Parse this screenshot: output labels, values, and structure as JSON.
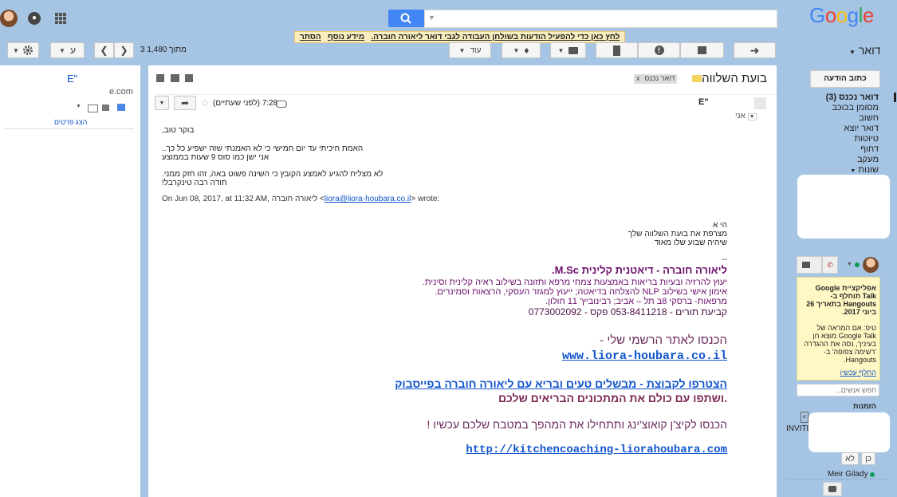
{
  "topbar": {
    "search_placeholder": "",
    "logo": "Google",
    "notice_text": "לחץ כאן כדי להפעיל הודעות בשולחן העבודה לגבי דואר ליאורה חוברה.",
    "notice_more": "מידע נוסף",
    "notice_hide": "הסתר"
  },
  "toolbar": {
    "settings_icon": "gear-icon",
    "lang_label": "ע",
    "pager_text": "3 מתוך 1,480",
    "more_label": "עוד",
    "mail_label": "דואר"
  },
  "left": {
    "name": "E\"",
    "email": "e.com",
    "show_details": "הצג פרטים"
  },
  "message": {
    "subject": "בועת השלווה",
    "label": "דואר נכנס",
    "label_close": "x",
    "sender": "E\"",
    "to_me": "אני",
    "time": "7:28 (לפני שעתיים)",
    "body_lines": [
      "בוקר טוב,",
      "האמת חיכיתי עד יום חמישי כי לא האמנתי שזה ישפיע כל כך..",
      "אני ישן כמו סוס 9 שעות בממוצע",
      "לא מצליח להגיע לאמצע הקובץ כי השינה פשוט באה, זהו חזק ממני.",
      "תודה רבה טינקרבל!"
    ],
    "quote_prefix": "On Jun 08, 2017, at 11:32 AM, ליאורה חוברה <",
    "quote_email": "liora@liora-houbara.co.il",
    "quote_suffix": "> wrote:",
    "quoted_lines": [
      "הי א",
      "מצרפת את בועת השלווה שלך",
      "שיהיה שבוע שלו מאוד"
    ],
    "sig_dash": "--",
    "sig_title": "ליאורה חוברה  - דיאטנית קלינית M.Sc.",
    "sig_lines": [
      "יעוץ להרזיה ובעיות בריאות באמצעות צמחי מרפא ותזונה בשילוב ראיה קלינית וסינית.",
      "אימון אישי בשילוב NLP להצלחה בדיאטה; ייעוץ למגזר העסקי, הרצאות וסמינרים.",
      "מרפאות- ברסקי 8ב תל – אביב; רבינוביץ' 11 חולון.",
      "קביעת תורים - 053-8411218 פקס - 0773002092"
    ],
    "site_intro": "הכנסו לאתר הרשמי שלי -",
    "site_link": "www.liora-houbara.co.il",
    "fb_link": "הצטרפו  לקבוצת  - מבשלים טעים ובריא עם ליאורה חוברה בפייסבוק",
    "fb_line2": ".ושתפו עם כולם את המתכונים הבריאים שלכם",
    "kitchen_line": "הכנסו לקיצ'ן קואוצ'ינג ותתחילו את המהפך במטבח שלכם עכשיו !",
    "kitchen_link": "http://kitchencoaching-liorahoubara.com"
  },
  "nav": {
    "compose": "כתוב הודעה",
    "items": [
      "דואר נכנס (3)",
      "מסומן בכוכב",
      "חשוב",
      "דואר יוצא",
      "טיוטות",
      "דחוף",
      "מעקב",
      "שונות"
    ]
  },
  "hangouts": {
    "promo_title": "אפליקציית Google Talk תוחלף ב-Hangouts בתאריך 26 ביוני 2017.",
    "promo_tip": "טיפ: אם המראה של Google Talk מוצא חן בעיניך, נסה את ההגדרה 'רשימה צפופה' ב-Hangouts.",
    "promo_link": "החלף עכשיו",
    "search_placeholder": "חפש אנשים...",
    "invites_header": "הזמנות",
    "invite_label": "INVITE",
    "yes": "כן",
    "no": "לא",
    "contact": "Meir Gilady"
  }
}
